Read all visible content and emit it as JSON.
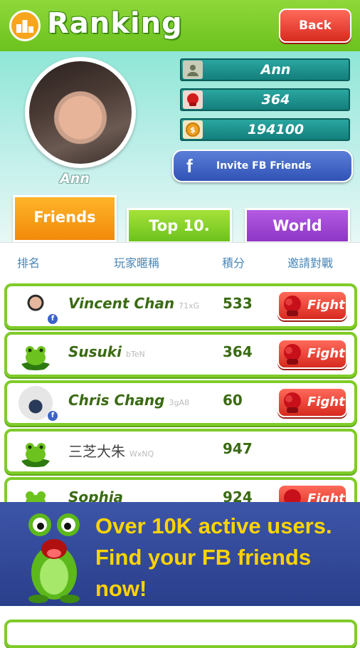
{
  "header": {
    "title": "Ranking",
    "back_label": "Back"
  },
  "profile": {
    "name": "Ann",
    "stats": {
      "name": "Ann",
      "gloves": "364",
      "coins": "194100"
    }
  },
  "invite_label": "Invite FB Friends",
  "tabs": {
    "friends": "Friends",
    "top10": "Top 10.",
    "world": "World"
  },
  "columns": {
    "rank": "排名",
    "nickname": "玩家暱稱",
    "score": "積分",
    "challenge": "邀請對戰"
  },
  "rows": [
    {
      "name": "Vincent Chan",
      "code": "71xG",
      "score": "533",
      "fight": "Fight"
    },
    {
      "name": "Susuki",
      "code": "bTeN",
      "score": "364",
      "fight": "Fight"
    },
    {
      "name": "Chris Chang",
      "code": "3gA8",
      "score": "60",
      "fight": "Fight"
    },
    {
      "name": "三芝大朱",
      "code": "WxNQ",
      "score": "947",
      "fight": ""
    },
    {
      "name": "Sophia",
      "code": "",
      "score": "924",
      "fight": "Fight"
    }
  ],
  "banner": {
    "text": "Over 10K active users. Find your FB friends now!"
  },
  "colors": {
    "green": "#7fcc29",
    "orange": "#f28a0a",
    "purple": "#8e36c6",
    "red": "#d72a1f",
    "banner_bg": "#2a3f8c",
    "banner_text": "#ffd400"
  }
}
